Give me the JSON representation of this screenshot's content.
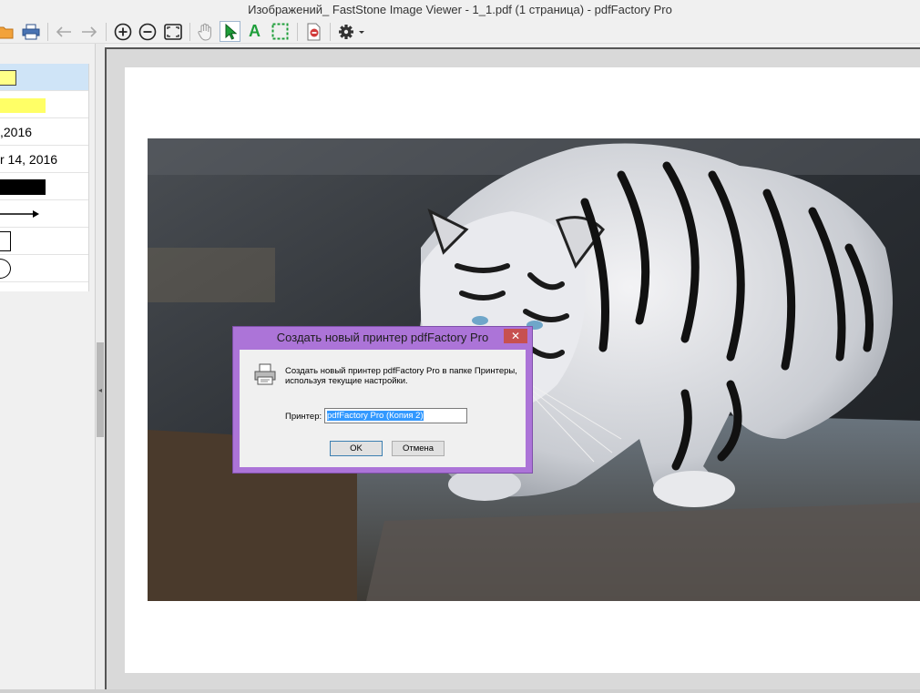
{
  "window": {
    "title": "Изображений_ FastStone Image Viewer - 1_1.pdf (1 страница) - pdfFactory Pro"
  },
  "toolbar": {
    "buttons": [
      {
        "name": "open",
        "icon": "folder-icon"
      },
      {
        "name": "print",
        "icon": "printer-icon"
      },
      {
        "name": "back",
        "icon": "arrow-left-icon"
      },
      {
        "name": "forward",
        "icon": "arrow-right-icon"
      },
      {
        "name": "zoom-in",
        "icon": "zoom-in-icon"
      },
      {
        "name": "zoom-out",
        "icon": "zoom-out-icon"
      },
      {
        "name": "fit",
        "icon": "fit-window-icon"
      },
      {
        "name": "hand",
        "icon": "hand-icon"
      },
      {
        "name": "select",
        "icon": "pointer-icon"
      },
      {
        "name": "text",
        "icon": "text-tool-icon"
      },
      {
        "name": "marquee",
        "icon": "marquee-icon"
      },
      {
        "name": "delete-page",
        "icon": "delete-page-icon"
      },
      {
        "name": "settings",
        "icon": "gear-icon"
      }
    ],
    "text_tool_glyph": "A"
  },
  "left_panel": {
    "items": [
      {
        "label": "",
        "kind": "note",
        "fill": "#ffff88",
        "selected": true
      },
      {
        "label": "",
        "kind": "highlight",
        "fill": "#ffff66"
      },
      {
        "label": ",2016",
        "kind": "date"
      },
      {
        "label": "r 14, 2016",
        "kind": "date"
      },
      {
        "label": "",
        "kind": "redact",
        "fill": "#000000"
      },
      {
        "label": "",
        "kind": "arrow"
      },
      {
        "label": "",
        "kind": "rectangle"
      },
      {
        "label": "",
        "kind": "circle"
      }
    ]
  },
  "dialog": {
    "title": "Создать новый принтер pdfFactory Pro",
    "close_glyph": "✕",
    "message": "Создать новый принтер pdfFactory Pro в папке Принтеры, используя текущие настройки.",
    "printer_label": "Принтер:",
    "printer_value": "pdfFactory Pro (Копия 2)",
    "ok_label": "OK",
    "cancel_label": "Отмена",
    "icon": "printer-icon"
  },
  "colors": {
    "dialog_frame": "#ac74d8",
    "close_button": "#c75050",
    "selection": "#3399ff",
    "active_tool": "#1e9e3a"
  }
}
